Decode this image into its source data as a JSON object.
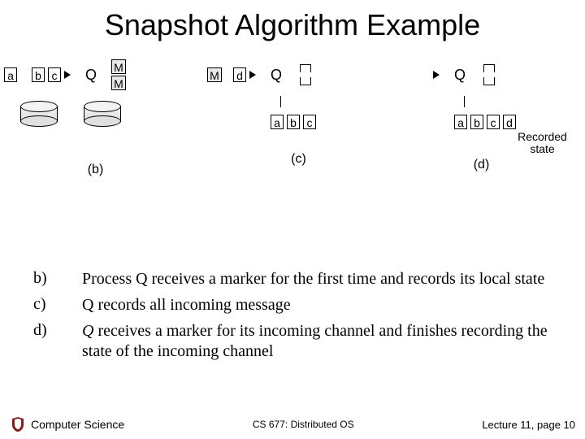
{
  "title": "Snapshot Algorithm Example",
  "diagram": {
    "a": "a",
    "b": "b",
    "c": "c",
    "d": "d",
    "M": "M",
    "Q": "Q",
    "cap_b": "(b)",
    "cap_c": "(c)",
    "cap_d": "(d)",
    "recorded": "Recorded",
    "state": "state"
  },
  "bullets": {
    "b_label": "b)",
    "b_text": "Process Q receives a marker for the first time and records its local state",
    "c_label": "c)",
    "c_text": "Q records all incoming message",
    "d_label": "d)",
    "d_text_pre": "Q",
    "d_text_rest": " receives a marker for its incoming channel and finishes recording the state of the incoming channel"
  },
  "footer": {
    "dept": "Computer Science",
    "course": "CS 677: Distributed OS",
    "page": "Lecture 11, page 10"
  }
}
